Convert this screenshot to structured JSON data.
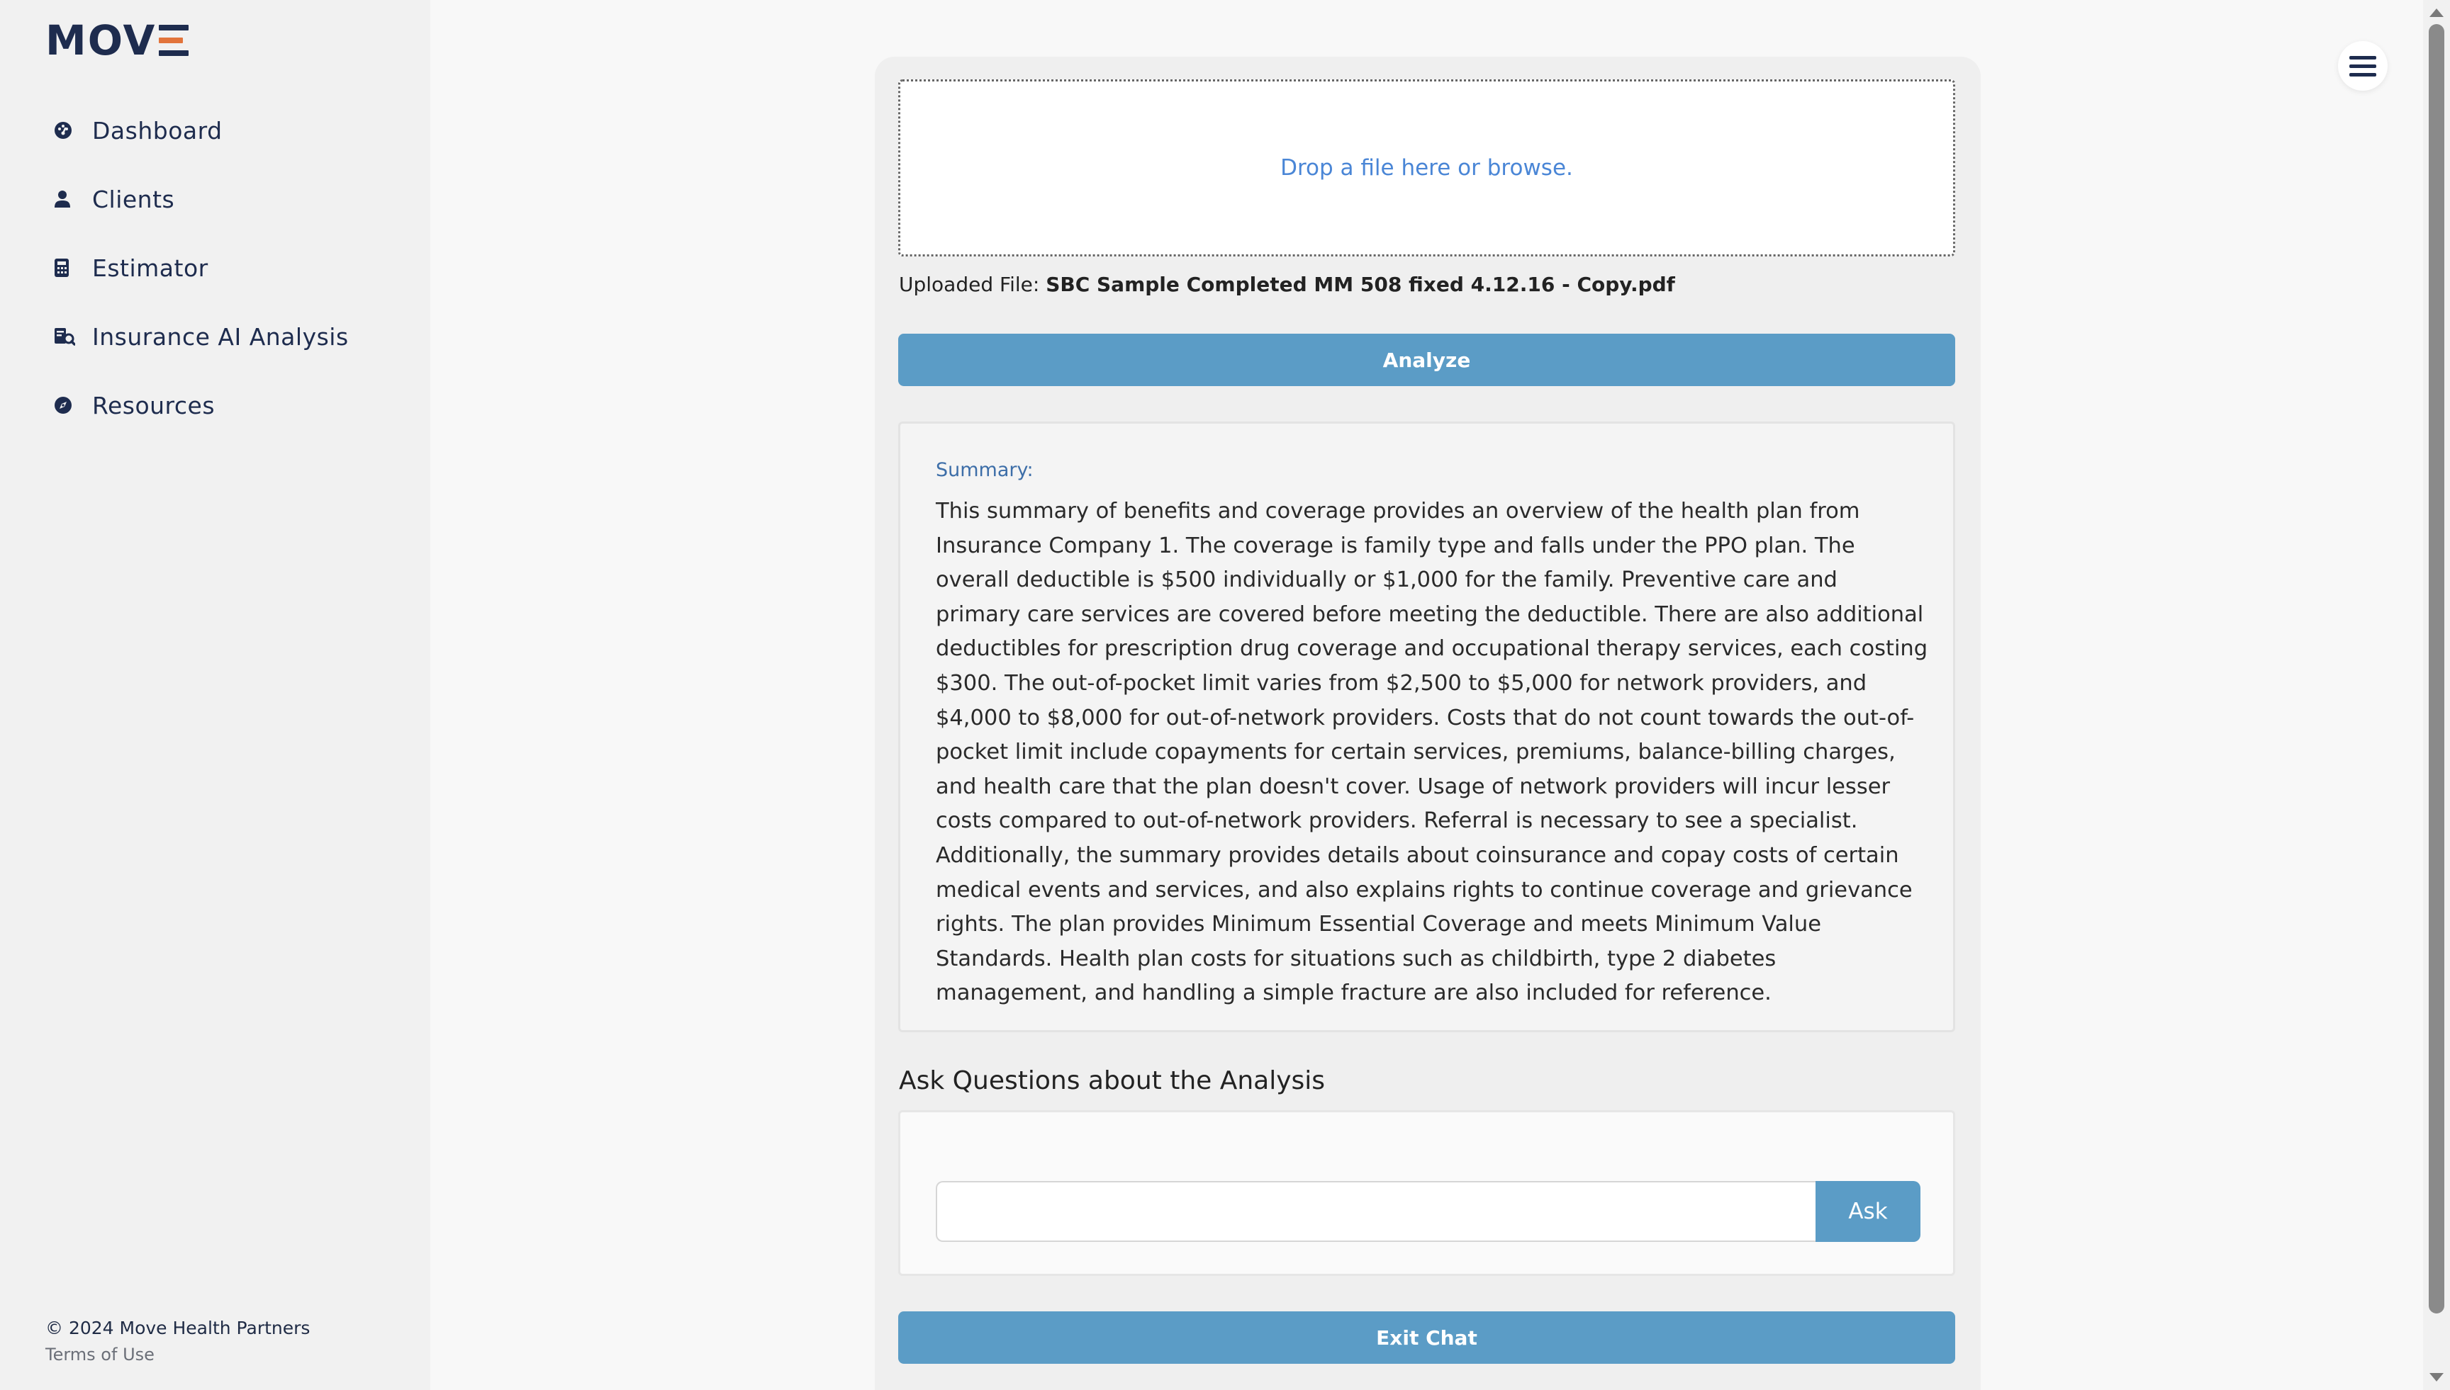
{
  "brand": {
    "logo_text": "MOV",
    "colors": {
      "navy": "#1e2c4e",
      "orange": "#e2743b",
      "button_blue": "#5b9cc6",
      "link_blue": "#4a86d6"
    }
  },
  "sidebar": {
    "items": [
      {
        "label": "Dashboard",
        "icon": "dashboard-icon"
      },
      {
        "label": "Clients",
        "icon": "user-icon"
      },
      {
        "label": "Estimator",
        "icon": "calculator-icon"
      },
      {
        "label": "Insurance AI Analysis",
        "icon": "document-analysis-icon"
      },
      {
        "label": "Resources",
        "icon": "compass-icon"
      }
    ],
    "footer": {
      "copyright": "© 2024 Move Health Partners",
      "terms": "Terms of Use"
    }
  },
  "upload": {
    "dropzone_text": "Drop a file here or browse.",
    "uploaded_label": "Uploaded File: ",
    "uploaded_filename": "SBC Sample Completed MM 508 fixed 4.12.16 - Copy.pdf"
  },
  "actions": {
    "analyze_label": "Analyze",
    "exit_label": "Exit Chat"
  },
  "summary": {
    "label": "Summary:",
    "text": "This summary of benefits and coverage provides an overview of the health plan from Insurance Company 1. The coverage is family type and falls under the PPO plan. The overall deductible is $500 individually or $1,000 for the family. Preventive care and primary care services are covered before meeting the deductible. There are also additional deductibles for prescription drug coverage and occupational therapy services, each costing $300. The out-of-pocket limit varies from $2,500 to $5,000 for network providers, and $4,000 to $8,000 for out-of-network providers. Costs that do not count towards the out-of-pocket limit include copayments for certain services, premiums, balance-billing charges, and health care that the plan doesn't cover. Usage of network providers will incur lesser costs compared to out-of-network providers. Referral is necessary to see a specialist. Additionally, the summary provides details about coinsurance and copay costs of certain medical events and services, and also explains rights to continue coverage and grievance rights. The plan provides Minimum Essential Coverage and meets Minimum Value Standards. Health plan costs for situations such as childbirth, type 2 diabetes management, and handling a simple fracture are also included for reference."
  },
  "chat": {
    "heading": "Ask Questions about the Analysis",
    "input_value": "",
    "input_placeholder": "",
    "ask_label": "Ask"
  }
}
